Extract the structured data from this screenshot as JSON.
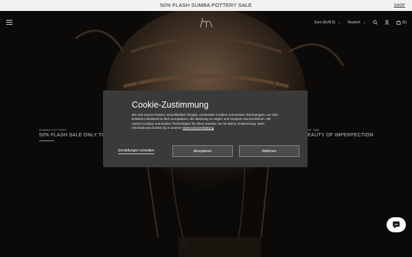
{
  "announcement": {
    "text": "50% FLASH SUMBA POTTERY SALE",
    "shop_label": "SHOP"
  },
  "header": {
    "currency": "Euro (EUR €)",
    "language": "Deutsch",
    "cart_count": "(0)",
    "icons": [
      "menu-icon",
      "logo",
      "search-icon",
      "account-icon",
      "cart-icon"
    ]
  },
  "slides": [
    {
      "label": "SUMBA POTTERY",
      "title": "50% FLASH SALE ONLY TODAY"
    },
    {
      "label": "AE SAE",
      "title": "EAUTY OF IMPERFECTION"
    }
  ],
  "cookie": {
    "title": "Cookie-Zustimmung",
    "body": "Wir und unsere Partner, einschließlich Shopify, verwenden Cookies und weitere Technologien, um dein Erlebnis individuell an dich anzupassen, die Werbung zu zeigen und Analysen durchzuführen. Wir nutzen Cookies und andere Technologien für diese Zwecke nur mit deiner Zustimmung. Mehr Informationen findest du in unserer",
    "link": "Datenschutzerklärung",
    "settings": "Einstellungen verwalten",
    "accept": "Akzeptieren",
    "decline": "Ablehnen"
  },
  "colors": {
    "announce_bg": "#f2f2f2",
    "modal_bg": "#3a3a3a",
    "button_bg": "#4b4b4b",
    "page_bg": "#0c0a08"
  }
}
